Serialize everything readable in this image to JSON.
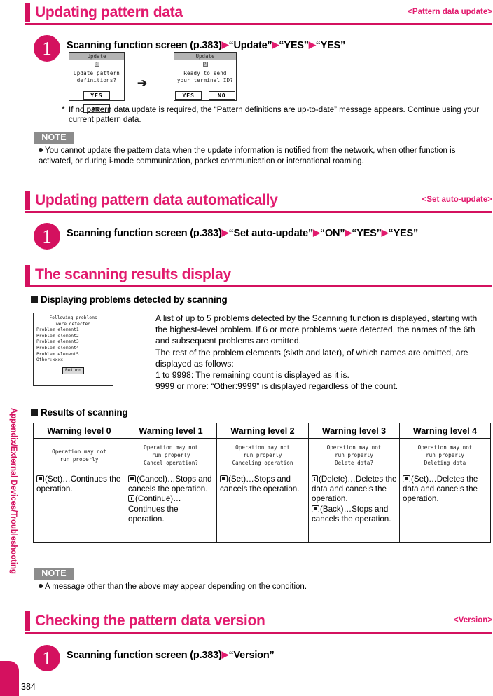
{
  "sidebar": {
    "label": "Appendix/External Devices/Troubleshooting",
    "accent": "#d4115f"
  },
  "page_number": "384",
  "sections": [
    {
      "title": "Updating pattern data",
      "tag": "<Pattern data update>"
    },
    {
      "title": "Updating pattern data automatically",
      "tag": "<Set auto-update>"
    },
    {
      "title": "The scanning results display",
      "tag": ""
    },
    {
      "title": "Checking the pattern data version",
      "tag": "<Version>"
    }
  ],
  "steps": {
    "step1": {
      "number": "1",
      "parts": [
        "Scanning function screen (p.383)",
        "“Update”",
        "“YES”",
        "“YES”"
      ]
    },
    "step2": {
      "number": "1",
      "parts": [
        "Scanning function screen (p.383)",
        "“Set auto-update”",
        "“ON”",
        "“YES”",
        "“YES”"
      ]
    },
    "step3": {
      "number": "1",
      "parts": [
        "Scanning function screen (p.383)",
        "“Version”"
      ]
    }
  },
  "mock_screen_1": {
    "title": "Update",
    "line1": "Update pattern",
    "line2": "definitions?",
    "yes": "YES",
    "no": "NO"
  },
  "mock_screen_2": {
    "title": "Update",
    "line1": "Ready to send",
    "line2": "your terminal ID?",
    "yes": "YES",
    "no": "NO"
  },
  "footnote": {
    "marker": "*",
    "text": "If no pattern data update is required, the “Pattern definitions are up-to-date” message appears. Continue using your current pattern data."
  },
  "note1": {
    "tag": "NOTE",
    "text": "You cannot update the pattern data when the update information is notified from the network, when other function is activated, or during i-mode communication, packet communication or international roaming."
  },
  "note2": {
    "tag": "NOTE",
    "text": "A message other than the above may appear depending on the condition."
  },
  "subheads": {
    "displaying": "Displaying problems detected by scanning",
    "results": "Results of scanning"
  },
  "mock_list": {
    "header1": "Following problems",
    "header2": "were detected",
    "items": [
      "Problem element1",
      "Problem element2",
      "Problem element3",
      "Problem element4",
      "Problem element5",
      "Other:xxxx"
    ],
    "return_button": "Return"
  },
  "scanning_body": [
    "A list of up to 5 problems detected by the Scanning function is displayed, starting with the highest-level problem. If 6 or more problems were detected, the names of the 6th and subsequent problems are omitted.",
    "The rest of the problem elements (sixth and later), of which names are omitted, are displayed as follows:",
    "1 to 9998: The remaining count is displayed as it is.",
    "9999 or more: “Other:9999” is displayed regardless of the count."
  ],
  "results_table": {
    "headers": [
      "Warning level 0",
      "Warning level 1",
      "Warning level 2",
      "Warning level 3",
      "Warning level 4"
    ],
    "messages": [
      [
        "Operation may not",
        "run properly"
      ],
      [
        "Operation may not",
        "run properly",
        "Cancel operation?"
      ],
      [
        "Operation may not",
        "run properly",
        "Canceling operation"
      ],
      [
        "Operation may not",
        "run properly",
        "Delete data?"
      ],
      [
        "Operation may not",
        "run properly",
        "Deleting data"
      ]
    ],
    "actions": [
      [
        {
          "icon": "set-key-icon",
          "label": "(Set)",
          "dots": "…",
          "text": "Continues the operation."
        }
      ],
      [
        {
          "icon": "set-key-icon",
          "label": "(Cancel)",
          "dots": "…",
          "text": "Stops and cancels the operation."
        },
        {
          "icon": "mail-key-icon",
          "label": "(Continue)",
          "dots": "…",
          "text": "Continues the operation."
        }
      ],
      [
        {
          "icon": "set-key-icon",
          "label": "(Set)",
          "dots": "…",
          "text": "Stops and cancels the operation."
        }
      ],
      [
        {
          "icon": "mail-key-icon",
          "label": "(Delete)",
          "dots": "…",
          "text": "Deletes the data and cancels the operation."
        },
        {
          "icon": "set-key-icon",
          "label": "(Back)",
          "dots": "…",
          "text": "Stops and cancels the operation."
        }
      ],
      [
        {
          "icon": "set-key-icon",
          "label": "(Set)",
          "dots": "…",
          "text": "Deletes the data and cancels the operation."
        }
      ]
    ]
  }
}
